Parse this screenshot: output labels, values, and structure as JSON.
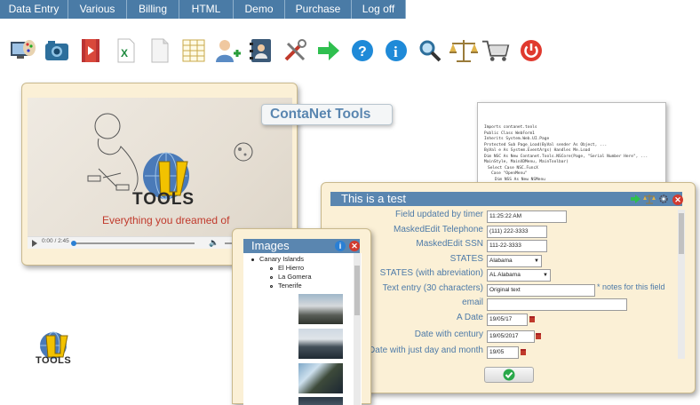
{
  "menu": [
    {
      "label": "Data Entry"
    },
    {
      "label": "Various"
    },
    {
      "label": "Billing"
    },
    {
      "label": "HTML"
    },
    {
      "label": "Demo"
    },
    {
      "label": "Purchase"
    },
    {
      "label": "Log off"
    }
  ],
  "toolbar": [
    {
      "icon": "art-palette-icon"
    },
    {
      "icon": "camera-icon"
    },
    {
      "icon": "video-file-icon"
    },
    {
      "icon": "excel-file-icon"
    },
    {
      "icon": "blank-document-icon"
    },
    {
      "icon": "spreadsheet-grid-icon"
    },
    {
      "icon": "add-user-icon"
    },
    {
      "icon": "contacts-book-icon"
    },
    {
      "icon": "tools-icon"
    },
    {
      "icon": "arrow-right-icon"
    },
    {
      "icon": "help-icon"
    },
    {
      "icon": "info-icon"
    },
    {
      "icon": "search-icon"
    },
    {
      "icon": "balance-scale-icon"
    },
    {
      "icon": "shopping-cart-icon"
    },
    {
      "icon": "power-icon"
    }
  ],
  "banner": {
    "text": "ContaNet Tools"
  },
  "video": {
    "tagline": "Everything you dreamed of",
    "logo_text": "TOOLS",
    "time": "0:00 / 2:45"
  },
  "code": {
    "lines": [
      "Imports contanet.tools",
      "Public Class WebForm1",
      "Inherits System.Web.UI.Page",
      "Protected Sub Page_Load(ByVal sender As Object, ...",
      "ByVal e As System.EventArgs) Handles Me.Load",
      "Dim NSC As New Contanet.Tools.NSCore(Page, \"Serial Number Here\", ...",
      "MainStyle, MainXDMenu, MainToolbar)",
      "Select Case NSC.FuncX",
      "Case \"OpenMenu\"",
      "Dim NSS As New NSMenu"
    ]
  },
  "form": {
    "title": "This is a test",
    "fields": [
      {
        "label": "Field updated by timer",
        "value": "11:25:22 AM",
        "kind": "input"
      },
      {
        "label": "MaskedEdit Telephone",
        "value": "(111) 222-3333",
        "kind": "input"
      },
      {
        "label": "MaskedEdit SSN",
        "value": "111-22-3333",
        "kind": "input"
      },
      {
        "label": "STATES",
        "value": "Alabama",
        "kind": "select"
      },
      {
        "label": "STATES (with abreviation)",
        "value": "AL Alabama",
        "kind": "select"
      },
      {
        "label": "Text entry (30 characters)",
        "value": "Original text",
        "kind": "input",
        "note": "* notes for this field"
      },
      {
        "label": "email",
        "value": "",
        "kind": "input"
      },
      {
        "label": "A Date",
        "value": "19/05/17",
        "kind": "date"
      },
      {
        "label": "Date with century",
        "value": "19/05/2017",
        "kind": "date"
      },
      {
        "label": "Date with just day and month",
        "value": "19/05",
        "kind": "date"
      }
    ]
  },
  "images": {
    "title": "Images",
    "tree": {
      "root": "Canary Islands",
      "children": [
        "El Hierro",
        "La Gomera",
        "Tenerife"
      ]
    }
  },
  "logo": {
    "text": "TOOLS"
  }
}
